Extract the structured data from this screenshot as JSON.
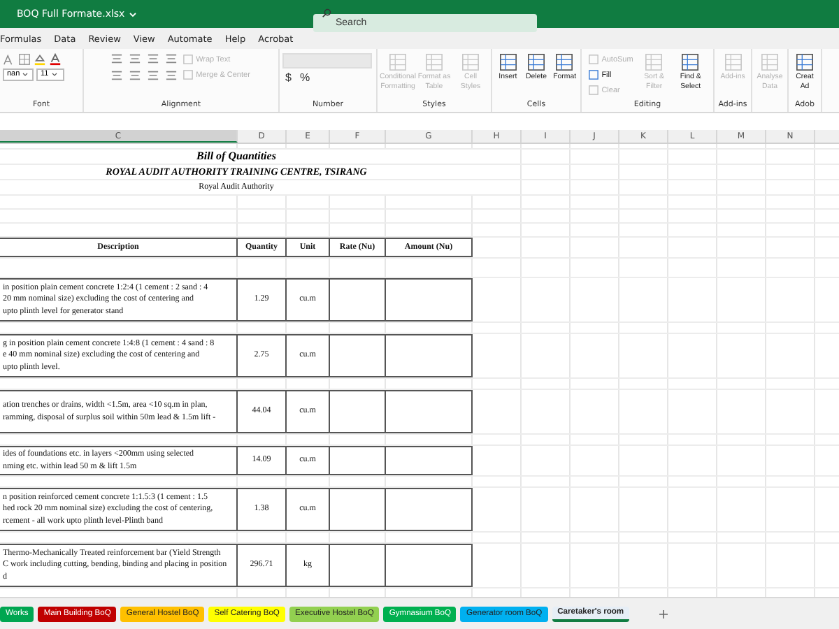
{
  "title_bar": {
    "file_name": "BOQ Full Formate.xlsx",
    "search": {
      "placeholder": "Search"
    }
  },
  "menu": [
    "Formulas",
    "Data",
    "Review",
    "View",
    "Automate",
    "Help",
    "Acrobat"
  ],
  "ribbon": {
    "groups": [
      {
        "kind": "font",
        "label": "Font",
        "controls": [
          {
            "kind": "dropdown",
            "label": "nan"
          },
          {
            "kind": "dropdown",
            "label": "11"
          }
        ]
      },
      {
        "kind": "alignment",
        "label": "Alignment",
        "controls": [
          {
            "kind": "small",
            "label": "Wrap Text",
            "disabled": true
          },
          {
            "kind": "small",
            "label": "Merge & Center",
            "disabled": true
          }
        ]
      },
      {
        "kind": "number",
        "label": "Number",
        "controls": [
          {
            "kind": "symbol",
            "label": "$"
          },
          {
            "kind": "symbol",
            "label": "%"
          }
        ]
      },
      {
        "kind": "styles",
        "label": "Styles",
        "controls": [
          {
            "kind": "large",
            "label": "Conditional Formatting",
            "disabled": true
          },
          {
            "kind": "large",
            "label": "Format as Table",
            "disabled": true
          },
          {
            "kind": "large",
            "label": "Cell Styles",
            "disabled": true
          }
        ]
      },
      {
        "kind": "cells",
        "label": "Cells",
        "controls": [
          {
            "kind": "large",
            "label": "Insert",
            "disabled": false
          },
          {
            "kind": "large",
            "label": "Delete",
            "disabled": false
          },
          {
            "kind": "large",
            "label": "Format",
            "disabled": false
          }
        ]
      },
      {
        "kind": "editing",
        "label": "Editing",
        "controls": [
          {
            "kind": "small",
            "label": "AutoSum",
            "disabled": true
          },
          {
            "kind": "small",
            "label": "Fill",
            "disabled": false
          },
          {
            "kind": "small",
            "label": "Clear",
            "disabled": true
          },
          {
            "kind": "large",
            "label": "Sort & Filter",
            "disabled": true
          },
          {
            "kind": "large",
            "label": "Find & Select",
            "disabled": false
          }
        ]
      },
      {
        "kind": "addins",
        "label": "Add-ins",
        "controls": [
          {
            "kind": "large",
            "label": "Add-ins",
            "disabled": true
          }
        ]
      },
      {
        "kind": "analyse",
        "controls": [
          {
            "kind": "large",
            "label": "Analyse Data",
            "disabled": true
          }
        ]
      },
      {
        "kind": "create",
        "label": "Adob",
        "controls": [
          {
            "kind": "large",
            "label": "Creat Ad",
            "disabled": false
          }
        ]
      }
    ]
  },
  "columns": [
    {
      "label": "C",
      "selected": true
    },
    {
      "label": "D",
      "selected": false
    },
    {
      "label": "E",
      "selected": false
    },
    {
      "label": "F",
      "selected": false
    },
    {
      "label": "G",
      "selected": false
    },
    {
      "label": "H",
      "selected": false
    },
    {
      "label": "I",
      "selected": false
    },
    {
      "label": "J",
      "selected": false
    },
    {
      "label": "K",
      "selected": false
    },
    {
      "label": "L",
      "selected": false
    },
    {
      "label": "M",
      "selected": false
    },
    {
      "label": "N",
      "selected": false
    }
  ],
  "headings": [
    {
      "kind": "title",
      "text": "Bill of Quantities"
    },
    {
      "kind": "subtitle",
      "text": "ROYAL AUDIT AUTHORITY TRAINING CENTRE, TSIRANG"
    },
    {
      "kind": "plain",
      "text": "Royal Audit Authority"
    }
  ],
  "table": {
    "columns": [
      "Description",
      "Quantity",
      "Unit",
      "Rate (Nu)",
      "Amount (Nu)"
    ],
    "rows": [
      {
        "description": [
          "in position plain cement concrete 1:2:4 (1 cement : 2 sand : 4",
          "20 mm nominal size) excluding the cost of centering and",
          "upto plinth level for generator stand"
        ],
        "quantity": "1.29",
        "unit": "cu.m"
      },
      {
        "description": [
          "g in position plain cement concrete 1:4:8 (1 cement : 4 sand : 8",
          "e 40 mm nominal size) excluding the cost of centering and",
          "upto plinth level."
        ],
        "quantity": "2.75",
        "unit": "cu.m"
      },
      {
        "description": [
          "ation trenches or drains, width <1.5m, area <10 sq.m in plan,",
          "ramming, disposal of surplus soil within 50m lead & 1.5m lift -"
        ],
        "quantity": "44.04",
        "unit": "cu.m"
      },
      {
        "description": [
          "ides of foundations etc. in layers <200mm using selected",
          "nming etc. within lead 50 m & lift 1.5m"
        ],
        "quantity": "14.09",
        "unit": "cu.m"
      },
      {
        "description": [
          "n position reinforced cement concrete 1:1.5:3 (1 cement : 1.5",
          "hed rock 20 mm nominal size) excluding the cost of centering,",
          "rcement - all work upto plinth level-Plinth band"
        ],
        "quantity": "1.38",
        "unit": "cu.m"
      },
      {
        "description": [
          "Thermo-Mechanically Treated reinforcement bar (Yield Strength",
          "C work including cutting, bending, binding and placing in position",
          "d"
        ],
        "quantity": "296.71",
        "unit": "kg"
      }
    ]
  },
  "sheet_tabs": [
    {
      "label": "Works",
      "color": "#00a651",
      "selected": false
    },
    {
      "label": "Main Building BoQ",
      "color": "#c00000",
      "selected": false
    },
    {
      "label": "General Hostel BoQ",
      "color": "#ffc000",
      "selected": false
    },
    {
      "label": "Self Catering BoQ",
      "color": "#ffff00",
      "selected": false
    },
    {
      "label": "Executive Hostel BoQ",
      "color": "#92d050",
      "selected": false
    },
    {
      "label": "Gymnasium BoQ",
      "color": "#00b050",
      "selected": false
    },
    {
      "label": "Generator room BoQ",
      "color": "#00b0f0",
      "selected": false
    },
    {
      "label": "Caretaker's room",
      "color": "#dde8f3",
      "selected": true
    }
  ]
}
